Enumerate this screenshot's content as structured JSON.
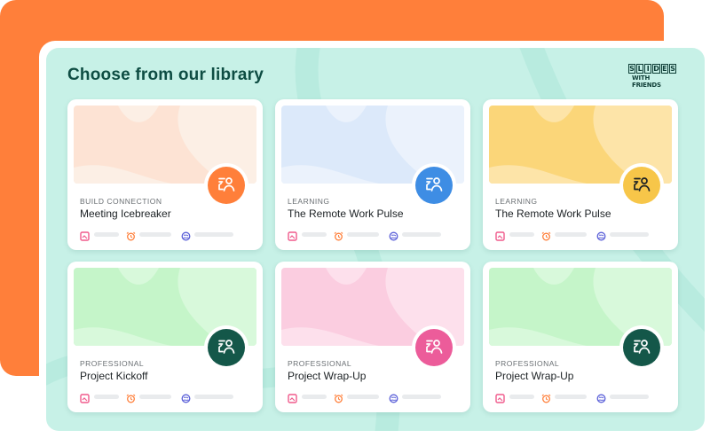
{
  "library": {
    "title": "Choose from our library",
    "logo": {
      "letters": [
        "S",
        "L",
        "I",
        "D",
        "E",
        "S"
      ],
      "subtitle": "WITH FRIENDS"
    }
  },
  "cards": [
    {
      "category": "BUILD CONNECTION",
      "name": "Meeting Icebreaker",
      "thumb_color": "#fde3d4",
      "thumb_shape_color": "#fcefe5",
      "badge_color": "#ff7f3a",
      "icon_color": "#ffffff"
    },
    {
      "category": "LEARNING",
      "name": "The Remote Work Pulse",
      "thumb_color": "#dce9fa",
      "thumb_shape_color": "#ebf2fc",
      "badge_color": "#3e8de4",
      "icon_color": "#ffffff"
    },
    {
      "category": "LEARNING",
      "name": "The Remote Work Pulse",
      "thumb_color": "#fbd679",
      "thumb_shape_color": "#fde4a8",
      "badge_color": "#f7c649",
      "icon_color": "#1c2124"
    },
    {
      "category": "PROFESSIONAL",
      "name": "Project Kickoff",
      "thumb_color": "#c5f5c9",
      "thumb_shape_color": "#d8f9db",
      "badge_color": "#145749",
      "icon_color": "#ffffff"
    },
    {
      "category": "PROFESSIONAL",
      "name": "Project Wrap-Up",
      "thumb_color": "#fbcde0",
      "thumb_shape_color": "#fde0ec",
      "badge_color": "#ec5c9a",
      "icon_color": "#ffffff"
    },
    {
      "category": "PROFESSIONAL",
      "name": "Project Wrap-Up",
      "thumb_color": "#c5f5c9",
      "thumb_shape_color": "#d8f9db",
      "badge_color": "#145749",
      "icon_color": "#ffffff"
    }
  ],
  "meta_icons": [
    "slides-icon",
    "alarm-clock-icon",
    "globe-icon"
  ],
  "colors": {
    "orange_backdrop": "#ff7f3a",
    "panel_bg": "#c7f1e7",
    "title_color": "#0e4d43"
  }
}
